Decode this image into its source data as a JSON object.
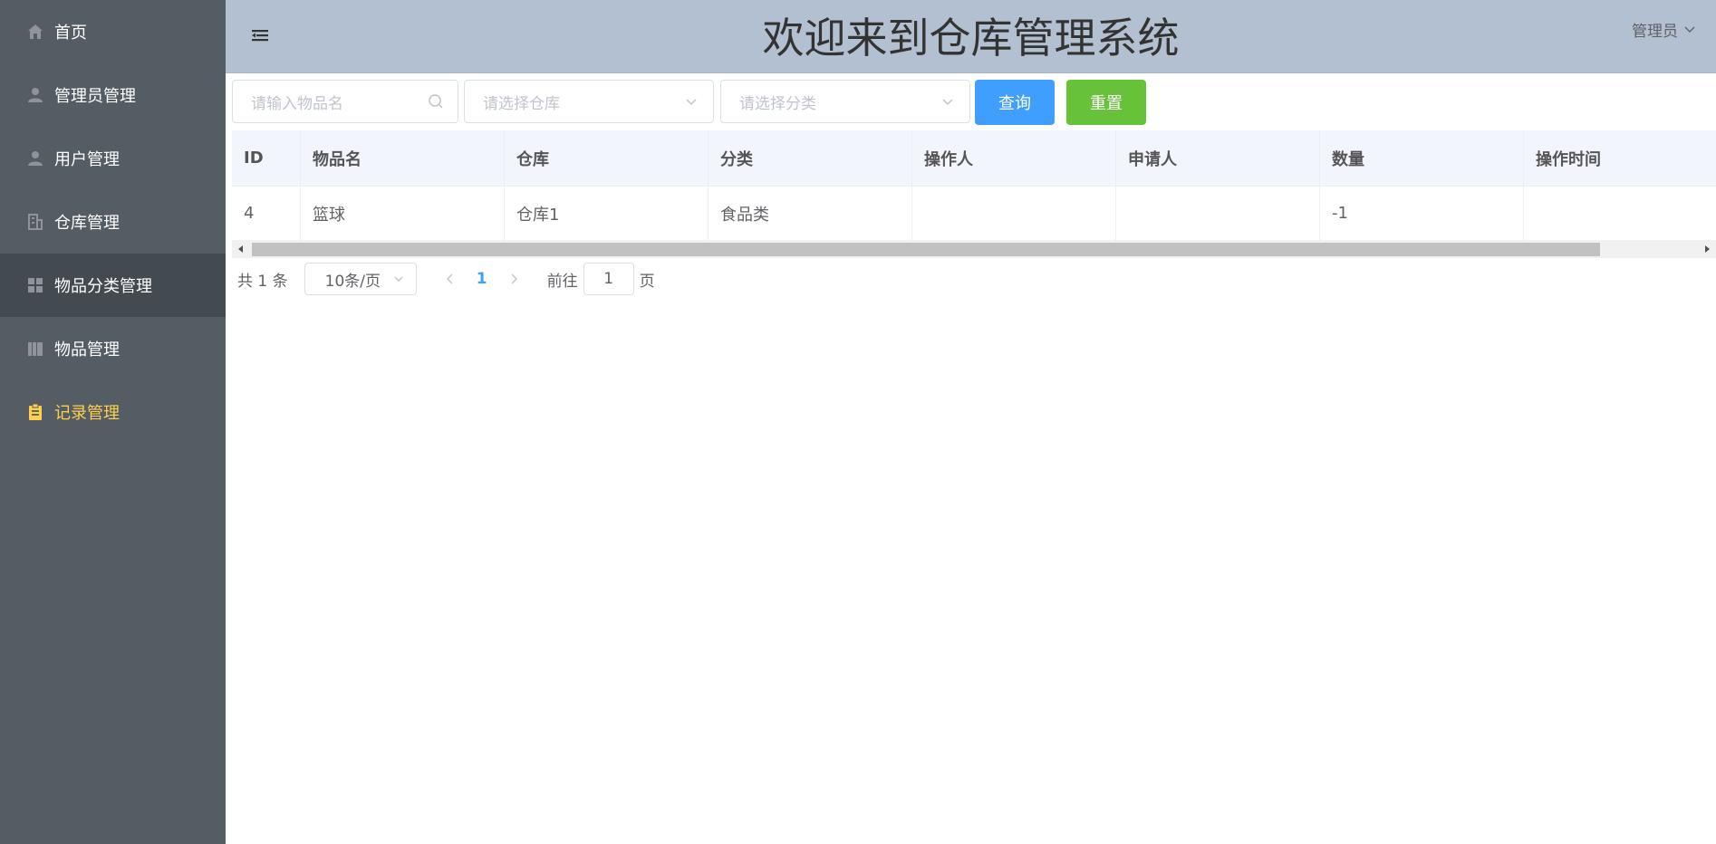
{
  "sidebar": {
    "items": [
      {
        "label": "首页",
        "icon": "home-icon"
      },
      {
        "label": "管理员管理",
        "icon": "user-icon"
      },
      {
        "label": "用户管理",
        "icon": "user-icon"
      },
      {
        "label": "仓库管理",
        "icon": "office-building-icon"
      },
      {
        "label": "物品分类管理",
        "icon": "grid-icon"
      },
      {
        "label": "物品管理",
        "icon": "notebook-icon"
      },
      {
        "label": "记录管理",
        "icon": "document-icon"
      }
    ],
    "hover_index": 4,
    "active_index": 6,
    "colors": {
      "background": "#545c64",
      "active_text": "#ffd04b",
      "hover": "#434a50"
    }
  },
  "header": {
    "title": "欢迎来到仓库管理系统",
    "user": "管理员",
    "background": "#b3c0d1"
  },
  "toolbar": {
    "search_placeholder": "请输入物品名",
    "storage_placeholder": "请选择仓库",
    "category_placeholder": "请选择分类",
    "query_label": "查询",
    "reset_label": "重置"
  },
  "table": {
    "columns": [
      "ID",
      "物品名",
      "仓库",
      "分类",
      "操作人",
      "申请人",
      "数量",
      "操作时间"
    ],
    "rows": [
      [
        "4",
        "篮球",
        "仓库1",
        "食品类",
        "",
        "",
        "-1",
        ""
      ]
    ]
  },
  "pagination": {
    "total": "共 1 条",
    "page_size": "10条/页",
    "current_page": "1",
    "goto_label": "前往",
    "goto_value": "1",
    "page_suffix": "页"
  }
}
